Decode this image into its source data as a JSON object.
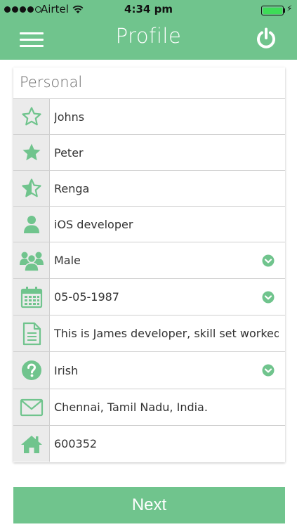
{
  "status_bar": {
    "carrier": "Airtel",
    "time": "4:34 pm",
    "signal_icon": "signal-dots-icon",
    "wifi_icon": "wifi-icon",
    "battery_icon": "battery-icon",
    "charging_icon": "charging-bolt-icon",
    "battery_level": 1.0
  },
  "nav": {
    "title": "Profile",
    "menu_icon": "hamburger-menu-icon",
    "power_icon": "power-icon"
  },
  "colors": {
    "accent": "#70c48d",
    "icon_bg": "#ebebeb",
    "text": "#333333",
    "section_title": "#6a6a6a",
    "battery": "#3ddc57"
  },
  "section": {
    "title": "Personal"
  },
  "fields": [
    {
      "value": "Johns",
      "icon": "star-outline-icon",
      "dropdown": false
    },
    {
      "value": "Peter",
      "icon": "star-filled-icon",
      "dropdown": false
    },
    {
      "value": "Renga",
      "icon": "star-half-icon",
      "dropdown": false
    },
    {
      "value": "iOS developer",
      "icon": "person-icon",
      "dropdown": false
    },
    {
      "value": "Male",
      "icon": "people-group-icon",
      "dropdown": true
    },
    {
      "value": "05-05-1987",
      "icon": "calendar-icon",
      "dropdown": true
    },
    {
      "value": "This is James developer, skill set worked…",
      "icon": "document-icon",
      "dropdown": false
    },
    {
      "value": "Irish",
      "icon": "question-circle-icon",
      "dropdown": true
    },
    {
      "value": "Chennai, Tamil Nadu, India.",
      "icon": "mail-icon",
      "dropdown": false
    },
    {
      "value": "600352",
      "icon": "home-icon",
      "dropdown": false
    }
  ],
  "next_button": {
    "label": "Next"
  }
}
